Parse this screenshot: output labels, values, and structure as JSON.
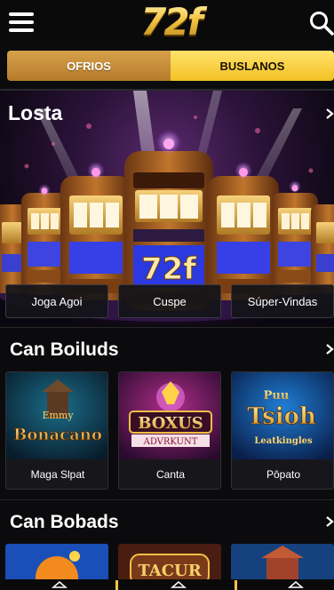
{
  "header": {
    "logo_text": "72f",
    "menu_icon": "hamburger-menu-icon",
    "search_icon": "search-icon"
  },
  "tabs": [
    {
      "label": "OFRIOS",
      "active": false
    },
    {
      "label": "BUSLANOS",
      "active": true
    }
  ],
  "hero": {
    "title": "Losta",
    "buttons": [
      "Joga Agoi",
      "Cuspe",
      "Súper-Vindas"
    ]
  },
  "rows": [
    {
      "title": "Can Boiluds",
      "games": [
        {
          "label": "Maga Slpat",
          "art_text": "Bonacano",
          "art_top": "Emmy"
        },
        {
          "label": "Canta",
          "art_text": "BOXUS",
          "art_sub": "ADVRKUNT"
        },
        {
          "label": "Pôpato",
          "art_text": "Tsioh",
          "art_top": "Puu",
          "art_sub": "Leatkingles"
        }
      ]
    },
    {
      "title": "Can Bobads",
      "games": [
        {
          "label": ""
        },
        {
          "label": "",
          "art_text": "TACUR"
        },
        {
          "label": ""
        }
      ]
    }
  ],
  "colors": {
    "gold": "#f4c542",
    "tab_left": "#c68d3a",
    "tab_right": "#f6c92e",
    "background": "#0b0b0d"
  }
}
